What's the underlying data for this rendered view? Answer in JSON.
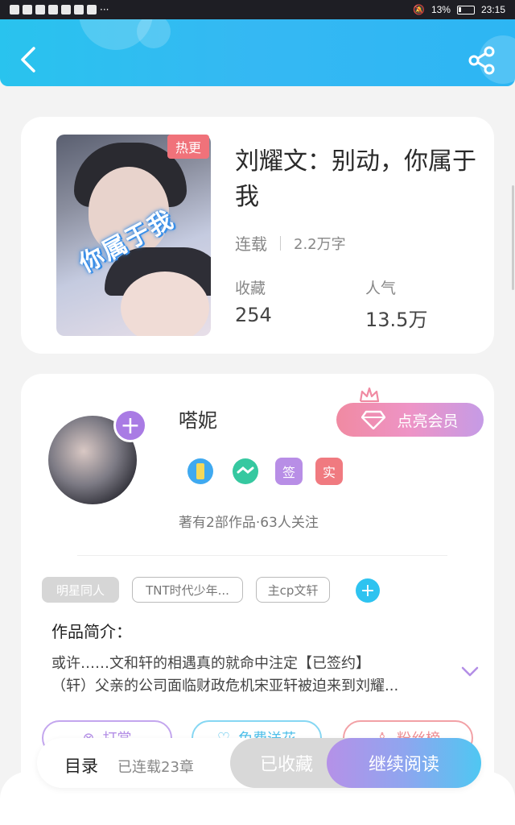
{
  "status_bar": {
    "battery": "13%",
    "time": "23:15"
  },
  "book": {
    "hot_badge": "热更",
    "title": "刘耀文：别动，你属于我",
    "cover_text": "你属于我",
    "status": "连载",
    "word_count": "2.2万字",
    "favorites_label": "收藏",
    "favorites_value": "254",
    "popularity_label": "人气",
    "popularity_value": "13.5万"
  },
  "author": {
    "name": "嗒妮",
    "vip_button": "点亮会员",
    "badges": [
      "签",
      "实"
    ],
    "stats": "著有2部作品·63人关注"
  },
  "tags": [
    "明星同人",
    "TNT时代少年...",
    "主cp文轩"
  ],
  "intro": {
    "title": "作品简介：",
    "line1": "或许……文和轩的相遇真的就命中注定【已签约】",
    "line2": "（轩）父亲的公司面临财政危机宋亚轩被迫来到刘耀..."
  },
  "actions": [
    "打赏",
    "免费送花",
    "粉丝榜"
  ],
  "bottom": {
    "toc_label": "目录",
    "toc_count": "已连载23章",
    "favorited": "已收藏",
    "continue": "继续阅读"
  },
  "colors": {
    "header": "#2db6f3",
    "vip_pink": "#f08aa2",
    "read_gradient_end": "#4fc7f2",
    "hot_red": "#f0727a"
  }
}
